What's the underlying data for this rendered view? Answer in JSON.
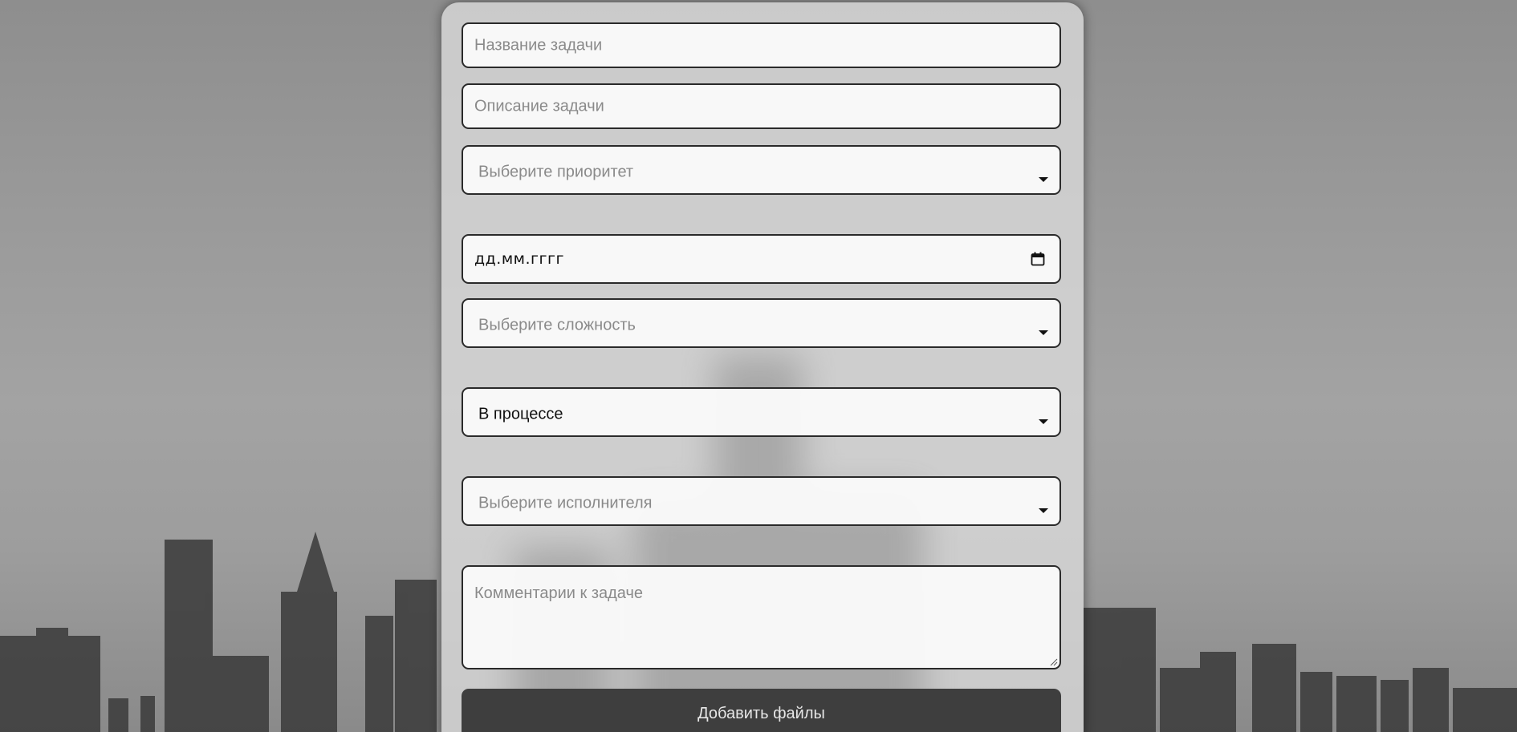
{
  "form": {
    "task_name": {
      "placeholder": "Название задачи"
    },
    "task_description": {
      "placeholder": "Описание задачи"
    },
    "priority": {
      "placeholder": "Выберите приоритет"
    },
    "due_date": {
      "value": "дд.мм.гггг",
      "icon": "calendar-icon"
    },
    "complexity": {
      "placeholder": "Выберите сложность"
    },
    "status": {
      "value": "В процессе"
    },
    "assignee": {
      "placeholder": "Выберите исполнителя"
    },
    "comments": {
      "placeholder": "Комментарии к задаче"
    },
    "add_files_label": "Добавить файлы"
  },
  "colors": {
    "field_border": "#2a2a2a",
    "button_bg": "#3e3e3e",
    "button_text": "#e6e6e6",
    "placeholder_text": "#8a8a8a"
  }
}
